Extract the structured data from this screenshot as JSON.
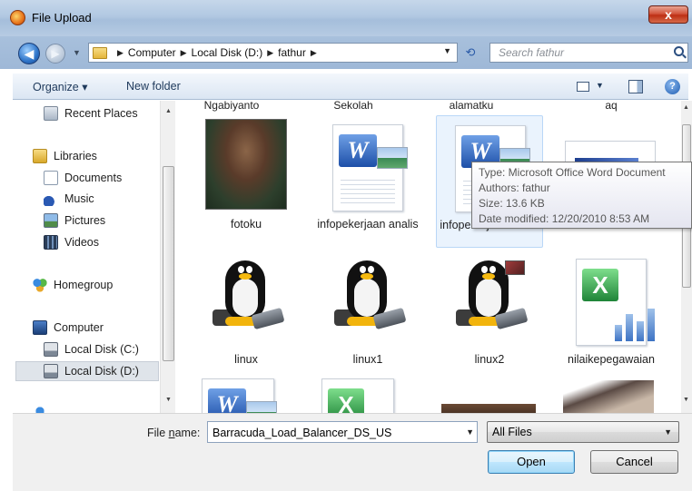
{
  "window": {
    "title": "File Upload",
    "close_label": "x"
  },
  "address": {
    "crumbs": [
      "Computer",
      "Local Disk (D:)",
      "fathur"
    ],
    "search_placeholder": "Search fathur"
  },
  "toolbar": {
    "organize_label": "Organize ▾",
    "new_folder_label": "New folder",
    "help_label": "?"
  },
  "nav": {
    "items": [
      {
        "label": "Recent Places",
        "icon": "recent-places-icon"
      },
      {
        "label": "Libraries",
        "icon": "libraries-icon"
      },
      {
        "label": "Documents",
        "icon": "documents-icon"
      },
      {
        "label": "Music",
        "icon": "music-icon"
      },
      {
        "label": "Pictures",
        "icon": "pictures-icon"
      },
      {
        "label": "Videos",
        "icon": "videos-icon"
      },
      {
        "label": "Homegroup",
        "icon": "homegroup-icon"
      },
      {
        "label": "Computer",
        "icon": "computer-icon"
      },
      {
        "label": "Local Disk (C:)",
        "icon": "drive-icon"
      },
      {
        "label": "Local Disk (D:)",
        "icon": "drive-icon",
        "selected": true
      }
    ]
  },
  "files": {
    "top_row_partial": [
      "Ngabiyanto",
      "Sekolah",
      "alamatku",
      "aq"
    ],
    "row1": [
      {
        "name": "fotoku",
        "type": "photo"
      },
      {
        "name": "infopekerjaan analis",
        "type": "word"
      },
      {
        "name": "infopekerjaan analis",
        "type": "word",
        "selected": true
      },
      {
        "name": "",
        "type": "pdf"
      }
    ],
    "row2": [
      {
        "name": "linux",
        "type": "linux-image"
      },
      {
        "name": "linux1",
        "type": "linux-image"
      },
      {
        "name": "linux2",
        "type": "linux-image"
      },
      {
        "name": "nilaikepegawaian",
        "type": "excel"
      }
    ]
  },
  "tooltip": {
    "type": "Type: Microsoft Office Word Document",
    "authors": "Authors: fathur",
    "size": "Size: 13.6 KB",
    "modified": "Date modified: 12/20/2010 8:53 AM"
  },
  "footer": {
    "file_name_label_pre": "File ",
    "file_name_label_ul": "n",
    "file_name_label_post": "ame:",
    "file_name_value": "Barracuda_Load_Balancer_DS_US",
    "file_type_value": "All Files",
    "open_label": "Open",
    "cancel_label": "Cancel"
  }
}
